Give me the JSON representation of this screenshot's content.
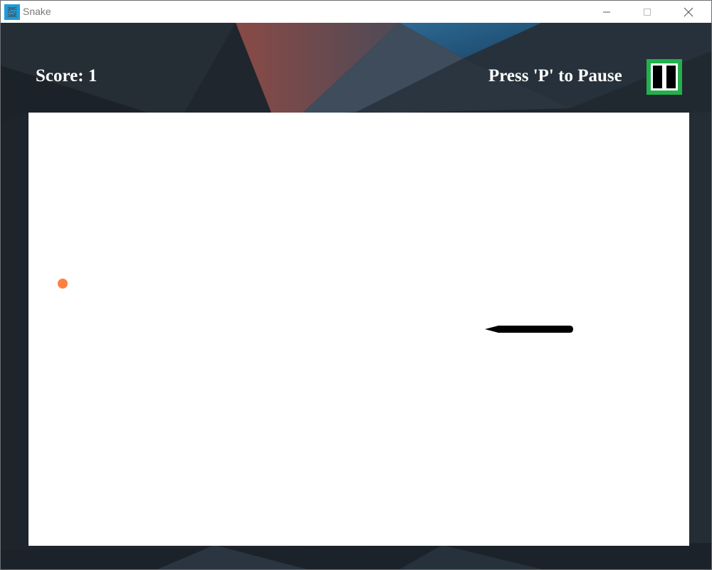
{
  "window": {
    "title": "Snake",
    "controls": [
      "minimize",
      "maximize",
      "close"
    ]
  },
  "hud": {
    "score_text": "Score: 1",
    "pause_hint": "Press 'P' to Pause"
  },
  "game": {
    "score": 1,
    "snake_direction": "left",
    "has_food": true
  },
  "colors": {
    "pause_button_border": "#22b14c",
    "food": "#ff7f3f",
    "snake": "#000000",
    "playfield": "#ffffff",
    "app_icon_bg": "#1f9bd7"
  },
  "icons": {
    "app": "snake-app-icon",
    "pause": "pause-icon",
    "minimize": "minimize-icon",
    "maximize": "maximize-icon",
    "close": "close-icon"
  }
}
